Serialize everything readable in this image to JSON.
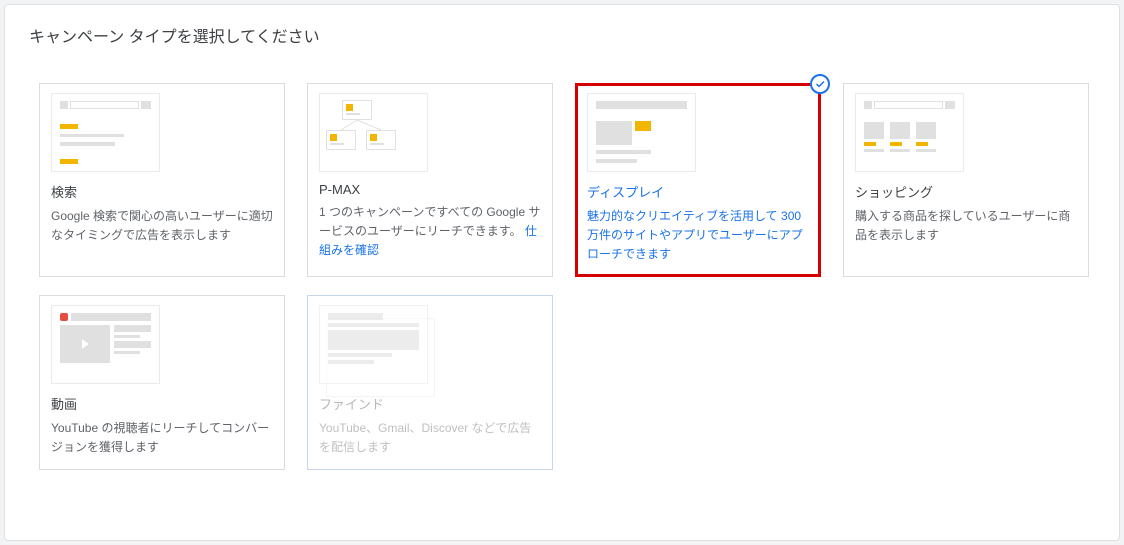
{
  "page_title": "キャンペーン タイプを選択してください",
  "cards": [
    {
      "key": "search",
      "title": "検索",
      "desc": "Google 検索で関心の高いユーザーに適切なタイミングで広告を表示します"
    },
    {
      "key": "pmax",
      "title": "P-MAX",
      "desc_prefix": "1 つのキャンペーンですべての Google サービスのユーザーにリーチできます。 ",
      "link": "仕組みを確認"
    },
    {
      "key": "display",
      "title": "ディスプレイ",
      "desc": "魅力的なクリエイティブを活用して 300 万件のサイトやアプリでユーザーにアプローチできます"
    },
    {
      "key": "shopping",
      "title": "ショッピング",
      "desc": "購入する商品を探しているユーザーに商品を表示します"
    },
    {
      "key": "video",
      "title": "動画",
      "desc": "YouTube の視聴者にリーチしてコンバージョンを獲得します"
    },
    {
      "key": "find",
      "title": "ファインド",
      "desc": "YouTube、Gmail、Discover などで広告を配信します"
    }
  ]
}
